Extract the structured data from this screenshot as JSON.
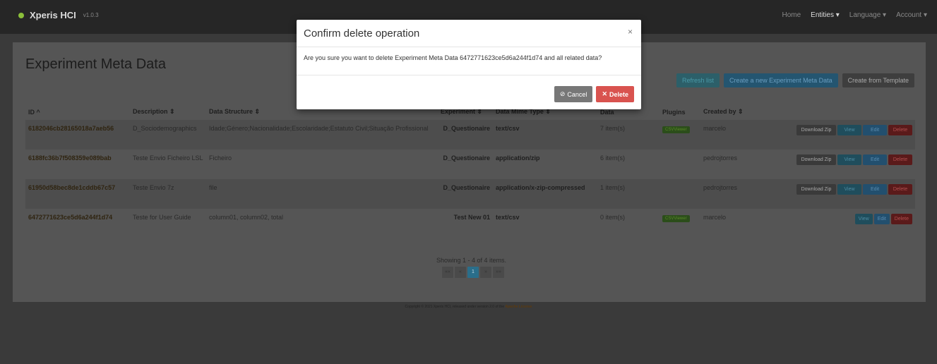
{
  "navbar": {
    "brand": "Xperis HCI",
    "version": "v1.0.3",
    "home": "Home",
    "entities": "Entities ▾",
    "language": "Language ▾",
    "account": "Account ▾"
  },
  "page": {
    "title": "Experiment Meta Data"
  },
  "toolbar": {
    "refresh": "Refresh list",
    "create": "Create a new Experiment Meta Data",
    "template": "Create from Template"
  },
  "table": {
    "headers": {
      "id": "ID ^",
      "description": "Description ⇕",
      "structure": "Data Structure ⇕",
      "experiment": "Experiment ⇕",
      "mime": "Data Mime Type ⇕",
      "data": "Data",
      "plugins": "Plugins",
      "created": "Created by ⇕"
    },
    "rows": [
      {
        "id": "6182046cb28165018a7aeb56",
        "description": "D_Sociodemographics",
        "structure": "Idade;Género;Nacionalidade;Escolaridade;Estatuto Civil;Situação Profissional",
        "experiment": "D_Questionaire",
        "mime": "text/csv",
        "data": "7 item(s)",
        "plugin": "CSVViewer",
        "created": "marcelo"
      },
      {
        "id": "6188fc36b7f508359e089bab",
        "description": "Teste Envio Ficheiro LSL",
        "structure": "Ficheiro",
        "experiment": "D_Questionaire",
        "mime": "application/zip",
        "data": "6 item(s)",
        "plugin": "",
        "created": "pedrojtorres"
      },
      {
        "id": "61950d58bec8de1cddb67c57",
        "description": "Teste Envio 7z",
        "structure": "file",
        "experiment": "D_Questionaire",
        "mime": "application/x-zip-compressed",
        "data": "1 item(s)",
        "plugin": "",
        "created": "pedrojtorres"
      },
      {
        "id": "6472771623ce5d6a244f1d74",
        "description": "Teste for User Guide",
        "structure": "column01, column02, total",
        "experiment": "Test New 01",
        "mime": "text/csv",
        "data": "0 item(s)",
        "plugin": "CSVViewer",
        "created": "marcelo"
      }
    ],
    "actions": {
      "download": "Download Zip",
      "view": "View",
      "edit": "Edit",
      "delete": "Delete"
    }
  },
  "pagination": {
    "summary": "Showing 1 - 4 of 4 items.",
    "first": "««",
    "prev": "«",
    "current": "1",
    "next": "»",
    "last": "»»"
  },
  "footer": {
    "text": "Copyright © 2021 Xperis HCI, released under version 2.0 of the",
    "link": "Apache License"
  },
  "modal": {
    "title": "Confirm delete operation",
    "close": "×",
    "body": "Are you sure you want to delete Experiment Meta Data 6472771623ce5d6a244f1d74 and all related data?",
    "cancel": "Cancel",
    "delete": "Delete"
  },
  "colors": {
    "delete": "#d9534f",
    "cancel": "#777777",
    "navbar": "#262626",
    "overlay": "#555555"
  }
}
